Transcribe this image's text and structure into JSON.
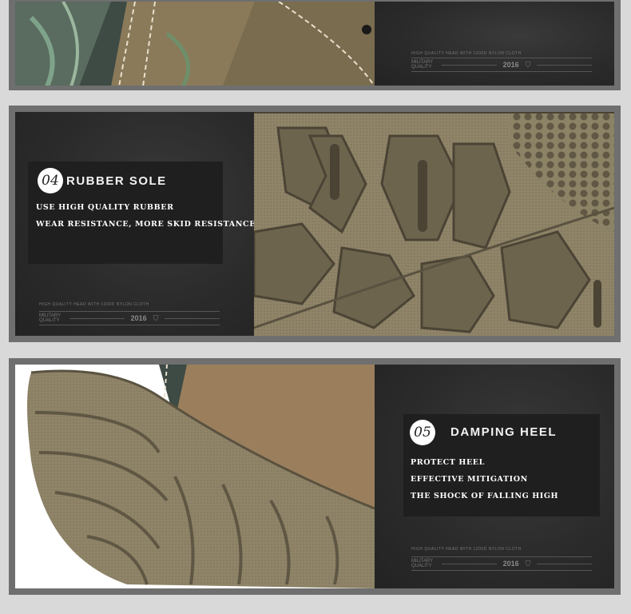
{
  "section_1": {
    "watermark": {
      "text": "HIGH QUALITY HEAD WITH 1200D NYLON CLOTH",
      "badge": "MILITARY QUALITY",
      "year": "2016"
    }
  },
  "section_2": {
    "number": "04",
    "title": "RUBBER SOLE",
    "features": [
      "USE HIGH QUALITY RUBBER",
      "WEAR RESISTANCE, MORE SKID RESISTANCE"
    ],
    "watermark": {
      "text": "HIGH QUALITY HEAD WITH 1200D NYLON CLOTH",
      "badge": "MILITARY QUALITY",
      "year": "2016"
    }
  },
  "section_3": {
    "number": "05",
    "title": "DAMPING HEEL",
    "features": [
      "PROTECT HEEL",
      "EFFECTIVE MITIGATION",
      "THE SHOCK OF FALLING HIGH"
    ],
    "watermark": {
      "text": "HIGH QUALITY HEAD WITH 1200D NYLON CLOTH",
      "badge": "MILITARY QUALITY",
      "year": "2016"
    }
  },
  "colors": {
    "frame": "#6f6f6f",
    "background": "#d9d9d9",
    "dark_panel": "#2b2b2b",
    "sole": "#8a7f66",
    "camo_green": "#4d6a4f"
  }
}
